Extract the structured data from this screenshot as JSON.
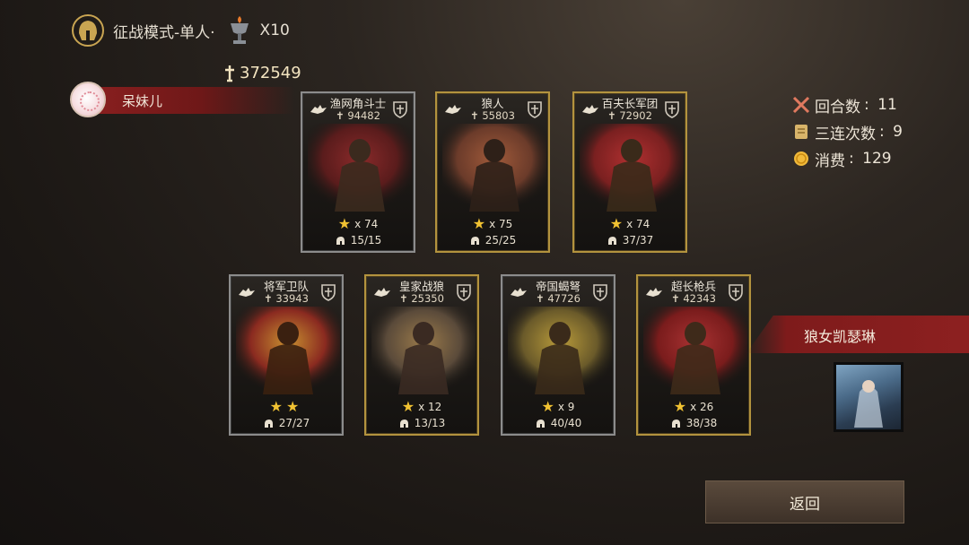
{
  "header": {
    "mode_label": "征战模式-单人·",
    "chalice_count": "X10",
    "mode_icon": "helmet-icon",
    "chalice_icon": "chalice-icon"
  },
  "player": {
    "power": "372549",
    "name": "呆妹儿"
  },
  "stats": {
    "rounds_label": "回合数",
    "rounds_value": "11",
    "combo_label": "三连次数",
    "combo_value": "9",
    "cost_label": "消费",
    "cost_value": "129"
  },
  "cards": [
    {
      "name": "渔网角斗士",
      "power": "94482",
      "stars_text": "x 74",
      "troops": "15/15",
      "frame": "silver",
      "stars": 1
    },
    {
      "name": "狼人",
      "power": "55803",
      "stars_text": "x 75",
      "troops": "25/25",
      "frame": "gold",
      "stars": 1
    },
    {
      "name": "百夫长军团",
      "power": "72902",
      "stars_text": "x 74",
      "troops": "37/37",
      "frame": "gold",
      "stars": 1
    },
    {
      "name": "将军卫队",
      "power": "33943",
      "stars_text": "",
      "troops": "27/27",
      "frame": "silver",
      "stars": 2
    },
    {
      "name": "皇家战狼",
      "power": "25350",
      "stars_text": "x 12",
      "troops": "13/13",
      "frame": "gold",
      "stars": 1
    },
    {
      "name": "帝国蝎弩",
      "power": "47726",
      "stars_text": "x 9",
      "troops": "40/40",
      "frame": "silver",
      "stars": 1
    },
    {
      "name": "超长枪兵",
      "power": "42343",
      "stars_text": "x 26",
      "troops": "38/38",
      "frame": "gold",
      "stars": 1
    }
  ],
  "hero": {
    "name": "狼女凯瑟琳"
  },
  "actions": {
    "back_label": "返回"
  },
  "colors": {
    "gold_frame": "#b3933e",
    "silver_frame": "#8c8c8c",
    "banner_red": "#8d2020",
    "star": "#f1c232"
  }
}
